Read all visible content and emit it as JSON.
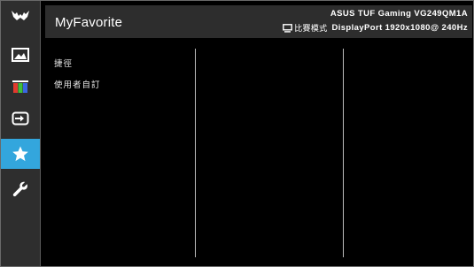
{
  "header": {
    "title": "MyFavorite",
    "model": "ASUS TUF Gaming  VG249QM1A",
    "mode": "比賽模式",
    "signal": "DisplayPort  1920x1080@ 240Hz"
  },
  "sidebar": {
    "items": [
      {
        "icon": "tuf-logo-icon",
        "active": false
      },
      {
        "icon": "image-icon",
        "active": false
      },
      {
        "icon": "color-bars-icon",
        "active": false
      },
      {
        "icon": "input-select-icon",
        "active": false
      },
      {
        "icon": "star-icon",
        "active": true
      },
      {
        "icon": "wrench-icon",
        "active": false
      }
    ]
  },
  "menu": {
    "items": [
      "捷徑",
      "使用者自訂"
    ]
  },
  "colors": {
    "accent": "#33a6dd",
    "sidebar_bg": "#2e2e2e",
    "header_bg": "#2d2d2d",
    "background": "#000000",
    "text": "#ffffff"
  }
}
